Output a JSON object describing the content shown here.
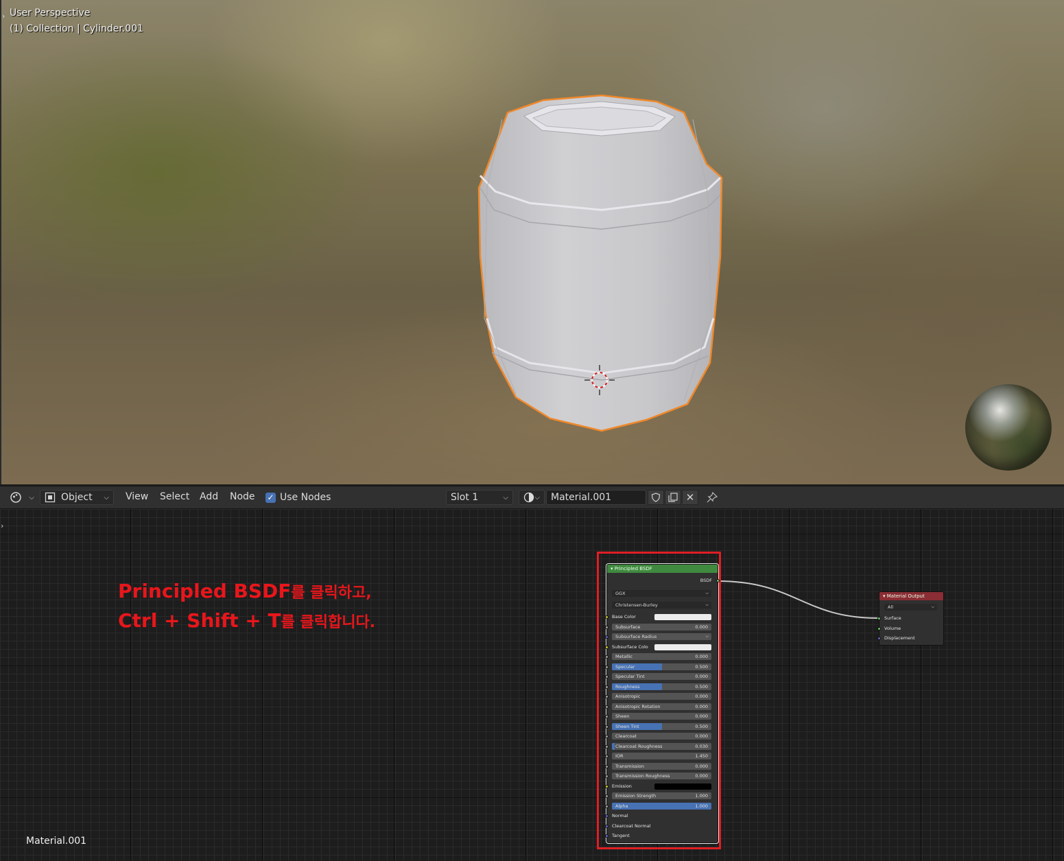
{
  "viewport": {
    "title": "User Perspective",
    "collection": "(1) Collection | Cylinder.001"
  },
  "node_header": {
    "editor_type_icon": "node-editor-icon",
    "mode": "Object",
    "menus": [
      "View",
      "Select",
      "Add",
      "Node"
    ],
    "use_nodes_label": "Use Nodes",
    "use_nodes_checked": true,
    "slot": "Slot 1",
    "material_name": "Material.001"
  },
  "instruction": {
    "line1_en": "Principled BSDF",
    "line1_ko": "를 클릭하고,",
    "line2_en": "Ctrl + Shift + T",
    "line2_ko": "를 클릭합니다."
  },
  "material_label": "Material.001",
  "bsdf_node": {
    "title": "Principled BSDF",
    "output": "BSDF",
    "distribution": "GGX",
    "subsurface_method": "Christensen-Burley",
    "rows": [
      {
        "label": "Base Color",
        "type": "color",
        "color": "#ececec",
        "socket": "yellow"
      },
      {
        "label": "Subsurface",
        "value": "0.000",
        "fill": 0.0
      },
      {
        "label": "Subsurface Radius",
        "type": "dropdown",
        "socket": "purple"
      },
      {
        "label": "Subsurface Colo",
        "type": "color",
        "color": "#ececec",
        "socket": "yellow"
      },
      {
        "label": "Metallic",
        "value": "0.000",
        "fill": 0.0
      },
      {
        "label": "Specular",
        "value": "0.500",
        "fill": 0.5
      },
      {
        "label": "Specular Tint",
        "value": "0.000",
        "fill": 0.0
      },
      {
        "label": "Roughness",
        "value": "0.500",
        "fill": 0.5
      },
      {
        "label": "Anisotropic",
        "value": "0.000",
        "fill": 0.0
      },
      {
        "label": "Anisotropic Rotation",
        "value": "0.000",
        "fill": 0.0
      },
      {
        "label": "Sheen",
        "value": "0.000",
        "fill": 0.0
      },
      {
        "label": "Sheen Tint",
        "value": "0.500",
        "fill": 0.5
      },
      {
        "label": "Clearcoat",
        "value": "0.000",
        "fill": 0.0
      },
      {
        "label": "Clearcoat Roughness",
        "value": "0.030",
        "fill": 0.03
      },
      {
        "label": "IOR",
        "value": "1.450",
        "fill": 0.0
      },
      {
        "label": "Transmission",
        "value": "0.000",
        "fill": 0.0
      },
      {
        "label": "Transmission Roughness",
        "value": "0.000",
        "fill": 0.0
      },
      {
        "label": "Emission",
        "type": "color",
        "color": "#000000",
        "socket": "yellow"
      },
      {
        "label": "Emission Strength",
        "value": "1.000",
        "fill": 0.0
      },
      {
        "label": "Alpha",
        "value": "1.000",
        "fill": 1.0
      },
      {
        "label": "Normal",
        "type": "plain",
        "socket": "purple"
      },
      {
        "label": "Clearcoat Normal",
        "type": "plain",
        "socket": "purple"
      },
      {
        "label": "Tangent",
        "type": "plain",
        "socket": "purple"
      }
    ]
  },
  "output_node": {
    "title": "Material Output",
    "target": "All",
    "inputs": [
      "Surface",
      "Volume",
      "Displacement"
    ]
  },
  "colors": {
    "highlight": "#e01e24",
    "instruction": "#e8161b",
    "slider_fill": "#4772b3",
    "selection_outline": "#f0882a"
  }
}
